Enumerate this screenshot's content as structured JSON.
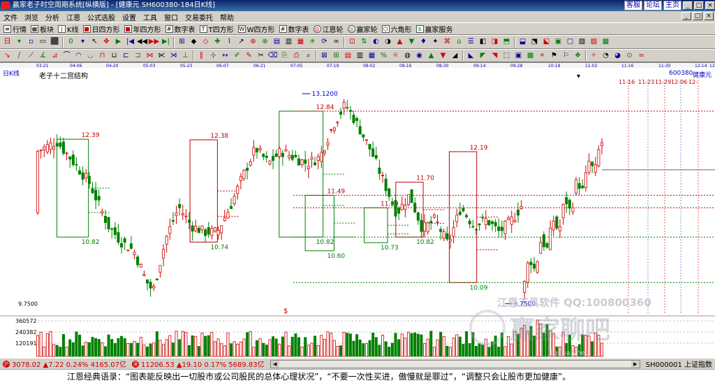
{
  "window": {
    "title": "赢家老子时空周期系统[纵横版] - [健康元  SH600380-184日K线]",
    "links": [
      "客服",
      "论坛",
      "主页"
    ]
  },
  "menu": [
    "文件",
    "浏览",
    "分析",
    "江恩",
    "公式选股",
    "设置",
    "工具",
    "窗口",
    "交易委托",
    "帮助"
  ],
  "toolbar1": [
    "行情",
    "板块",
    "K线",
    "日四方形",
    "年四方形",
    "数字表",
    "T四方形",
    "W四方形",
    "数字表",
    "江恩轮",
    "赢家轮",
    "六角形",
    "赢家服务"
  ],
  "chart_header": {
    "period_label": "日K线",
    "indicator_label": "老子十二宫结构",
    "code": "600380",
    "name": "健康元",
    "high_label": "13.1200",
    "low_label": "9.7500",
    "y_bottom_label": "9.7500",
    "dates_top": [
      "03-21",
      "04-06",
      "04-20",
      "05-03",
      "05-23",
      "06-07",
      "06-21",
      "07-05",
      "07-19",
      "08-02",
      "08-16",
      "08-30",
      "09-14",
      "09-28",
      "10-19",
      "11-02",
      "11-16",
      "11-30",
      "12-14",
      "12-"
    ],
    "future_dates": [
      "11-16",
      "11-23",
      "11-29",
      "12-06",
      "12-"
    ],
    "watermark": "江恩工具软件  QQ:100800360",
    "logo_text": "赢家聊吧",
    "logo_sub": "jlquba.vnet"
  },
  "volume_labels": [
    "360572",
    "240382",
    "120191"
  ],
  "status": {
    "sh": "3078.02  ▲7.22  0.24%  4165.07亿",
    "sz": "11206.53  ▲19.10  0.17%  5689.83亿",
    "right": "SH000001 上证指数"
  },
  "quote": "江恩经典语录：“图表能反映出一切股市或公司股民的总体心理状况”，“不要一次性买进，傲慢就是罪过”，“调整只会让股市更加健康”。",
  "chart_data": {
    "type": "candlestick",
    "title": "老子十二宫结构",
    "ylim": [
      9.6,
      13.3
    ],
    "price_levels": [
      12.84,
      12.39,
      12.38,
      12.19,
      11.7,
      11.49,
      11.29,
      10.82,
      10.74,
      10.73,
      10.6,
      10.09
    ],
    "boxes": [
      {
        "color": "green",
        "high": 12.39,
        "low": 10.82
      },
      {
        "color": "red",
        "high": 12.38,
        "low": 10.74
      },
      {
        "color": "green",
        "high": 12.84,
        "low": 10.82
      },
      {
        "color": "green",
        "high": 11.49,
        "low": 10.6
      },
      {
        "color": "green",
        "high": 11.29,
        "low": 10.73
      },
      {
        "color": "red",
        "high": 11.7,
        "low": 10.82
      },
      {
        "color": "red",
        "high": 12.19,
        "low": 10.09
      }
    ]
  }
}
